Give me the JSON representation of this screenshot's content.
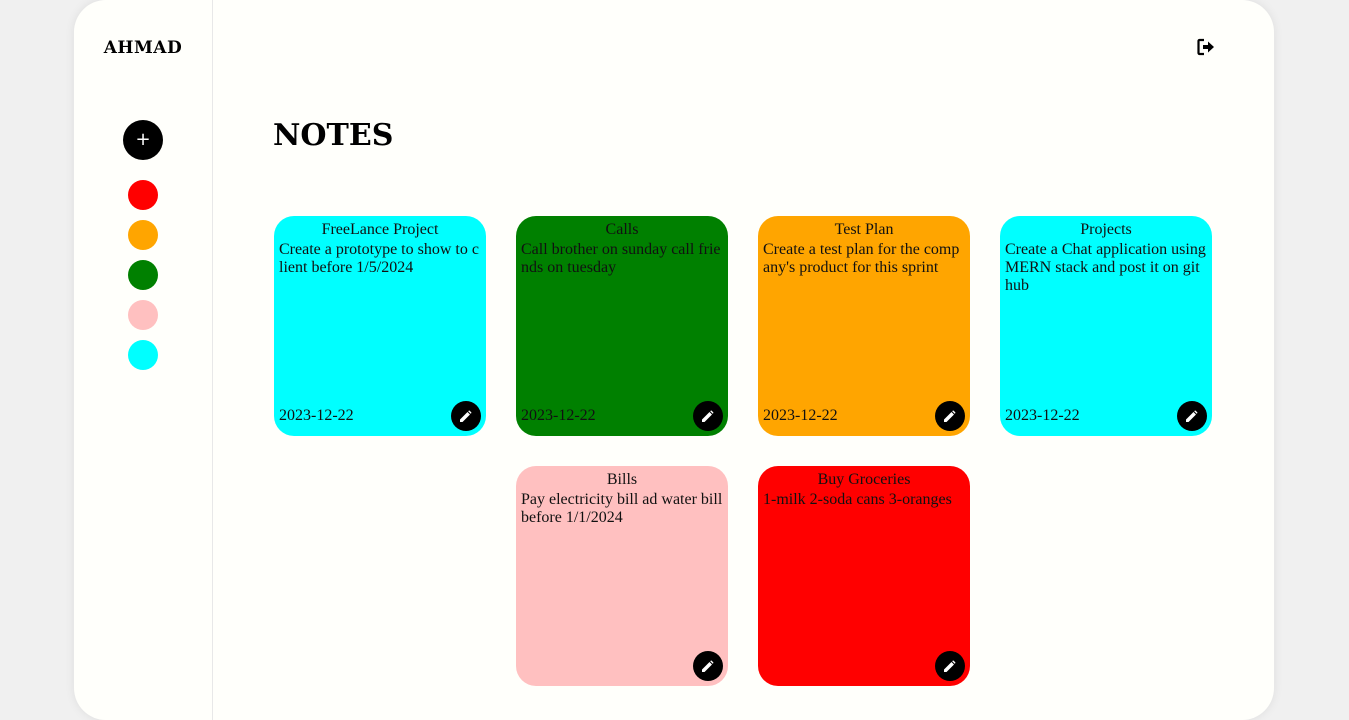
{
  "brand": "AHMAD",
  "add_button": "+",
  "swatches": [
    {
      "name": "red",
      "color": "#ff0000"
    },
    {
      "name": "orange",
      "color": "#ffa500"
    },
    {
      "name": "green",
      "color": "#008000"
    },
    {
      "name": "pink",
      "color": "#ffc0c0"
    },
    {
      "name": "cyan",
      "color": "#00ffff"
    }
  ],
  "page_title": "NOTES",
  "notes": [
    {
      "title": "FreeLance Project",
      "body": "Create a prototype to show to client before 1/5/2024",
      "date": "2023-12-22",
      "color": "#00ffff"
    },
    {
      "title": "Calls",
      "body": "Call brother on sunday call friends on tuesday",
      "date": "2023-12-22",
      "color": "#008000"
    },
    {
      "title": "Test Plan",
      "body": "Create a test plan for the company's product for this sprint",
      "date": "2023-12-22",
      "color": "#ffa500"
    },
    {
      "title": "Projects",
      "body": "Create a Chat application using MERN stack and post it on git hub",
      "date": "2023-12-22",
      "color": "#00ffff"
    },
    {
      "title": "Bills",
      "body": "Pay electricity bill ad water bill before 1/1/2024",
      "date": "",
      "color": "#ffc0c0"
    },
    {
      "title": "Buy Groceries",
      "body": "1-milk 2-soda cans 3-oranges",
      "date": "",
      "color": "#ff0000"
    }
  ],
  "icons": {
    "add": "plus-icon",
    "logout": "logout-icon",
    "edit": "pencil-icon"
  }
}
